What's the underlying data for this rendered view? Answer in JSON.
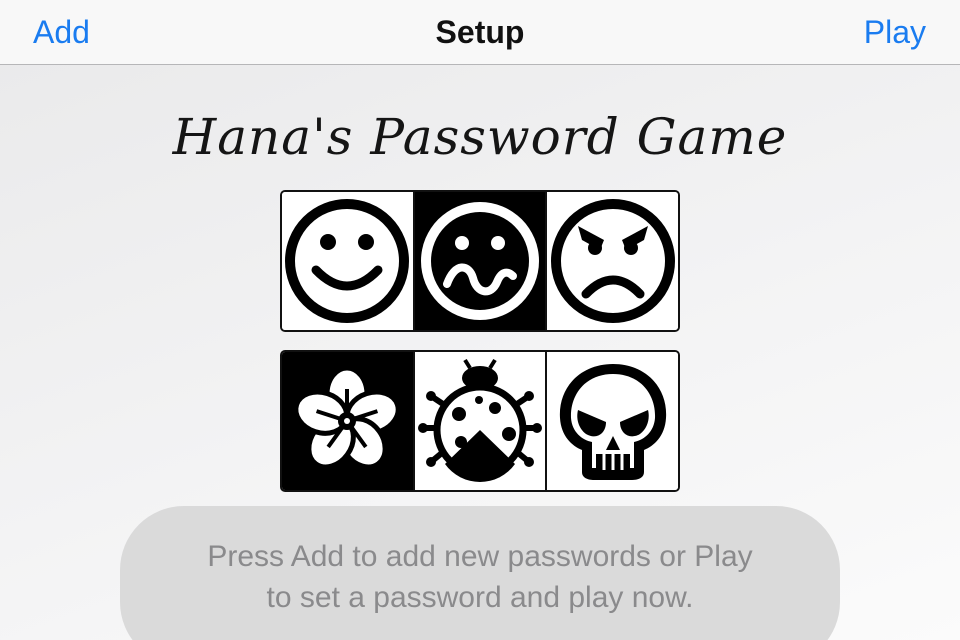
{
  "navbar": {
    "left_button": "Add",
    "title": "Setup",
    "right_button": "Play"
  },
  "game": {
    "title": "Hana's Password Game"
  },
  "tiles": {
    "row1": [
      "smiley-face-icon",
      "wavy-mouth-face-icon",
      "angry-face-icon"
    ],
    "row2": [
      "flower-icon",
      "ladybug-icon",
      "skull-icon"
    ]
  },
  "hint": {
    "text": "Press Add to add new passwords or Play\nto set a password and play now."
  },
  "colors": {
    "accent": "#1a7cf0",
    "bubble": "#dadada",
    "hint_text": "#8a8a8c"
  }
}
